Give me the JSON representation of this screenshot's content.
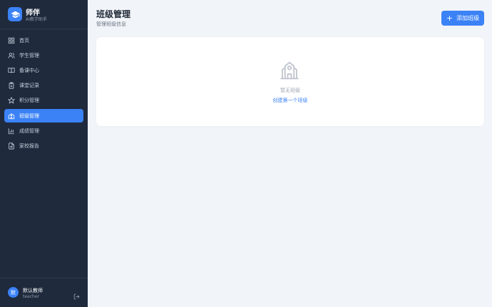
{
  "brand": {
    "name": "师伴",
    "subtitle": "AI教学助手",
    "icon": "graduation-cap-icon"
  },
  "sidebar": {
    "items": [
      {
        "label": "首页",
        "icon": "grid-icon",
        "active": false
      },
      {
        "label": "学生管理",
        "icon": "users-icon",
        "active": false
      },
      {
        "label": "备课中心",
        "icon": "book-open-icon",
        "active": false
      },
      {
        "label": "课堂记录",
        "icon": "clipboard-icon",
        "active": false
      },
      {
        "label": "积分管理",
        "icon": "star-icon",
        "active": false
      },
      {
        "label": "班级管理",
        "icon": "school-icon",
        "active": true
      },
      {
        "label": "成绩管理",
        "icon": "bar-chart-icon",
        "active": false
      },
      {
        "label": "家校报告",
        "icon": "file-text-icon",
        "active": false
      }
    ]
  },
  "user": {
    "avatar_text": "默",
    "name": "默认教师",
    "role": "teacher"
  },
  "header": {
    "title": "班级管理",
    "subtitle": "管理班级信息",
    "add_button": "添加班级"
  },
  "empty_state": {
    "message": "暂无班级",
    "link": "创建第一个班级",
    "icon": "school-icon"
  },
  "colors": {
    "sidebar_bg": "#1f2a3d",
    "accent": "#3b82f6",
    "page_bg": "#f1f4f8"
  }
}
